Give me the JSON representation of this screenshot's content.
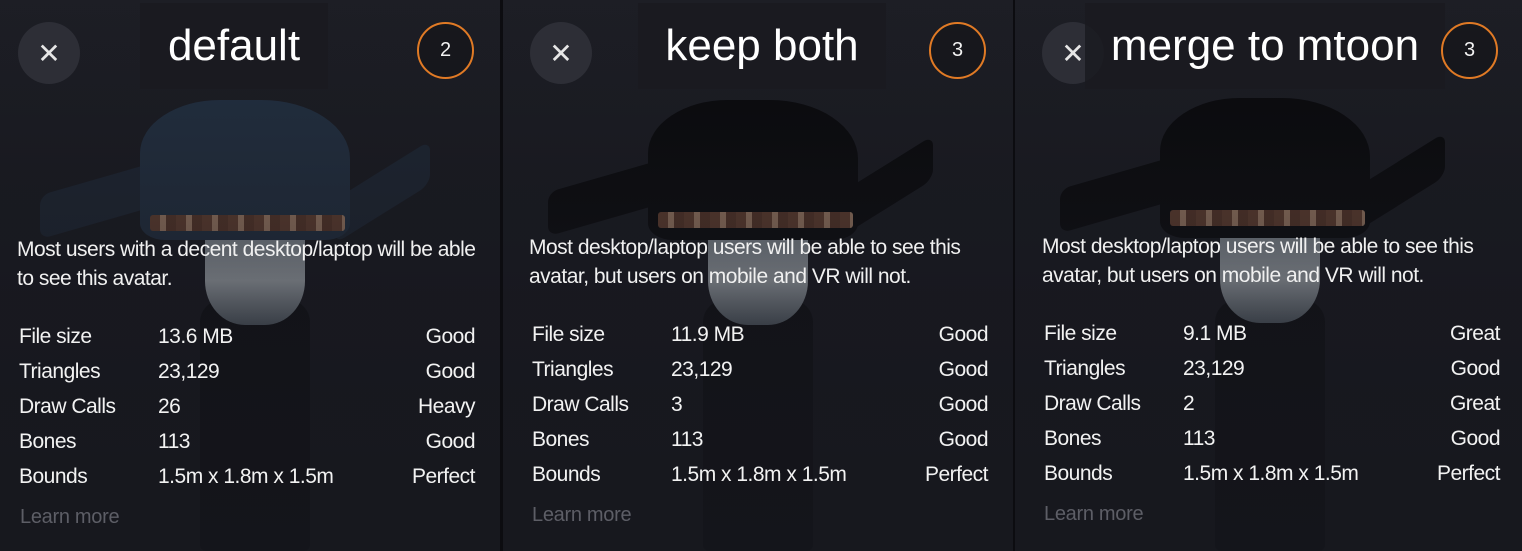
{
  "panels": [
    {
      "title": "default",
      "badge": "2",
      "description": "Most users with a decent desktop/laptop will be able to see this avatar.",
      "stats": [
        {
          "label": "File size",
          "value": "13.6 MB",
          "rating": "Good"
        },
        {
          "label": "Triangles",
          "value": "23,129",
          "rating": "Good"
        },
        {
          "label": "Draw Calls",
          "value": "26",
          "rating": "Heavy"
        },
        {
          "label": "Bones",
          "value": "113",
          "rating": "Good"
        },
        {
          "label": "Bounds",
          "value": "1.5m x 1.8m x 1.5m",
          "rating": "Perfect"
        }
      ],
      "learn_more": "Learn more"
    },
    {
      "title": "keep both",
      "badge": "3",
      "description": "Most desktop/laptop users will be able to see this avatar, but users on mobile and VR will not.",
      "stats": [
        {
          "label": "File size",
          "value": "11.9 MB",
          "rating": "Good"
        },
        {
          "label": "Triangles",
          "value": "23,129",
          "rating": "Good"
        },
        {
          "label": "Draw Calls",
          "value": "3",
          "rating": "Good"
        },
        {
          "label": "Bones",
          "value": "113",
          "rating": "Good"
        },
        {
          "label": "Bounds",
          "value": "1.5m x 1.8m x 1.5m",
          "rating": "Perfect"
        }
      ],
      "learn_more": "Learn more"
    },
    {
      "title": "merge to mtoon",
      "badge": "3",
      "description": "Most desktop/laptop users will be able to see this avatar, but users on mobile and VR will not.",
      "stats": [
        {
          "label": "File size",
          "value": "9.1 MB",
          "rating": "Great"
        },
        {
          "label": "Triangles",
          "value": "23,129",
          "rating": "Good"
        },
        {
          "label": "Draw Calls",
          "value": "2",
          "rating": "Great"
        },
        {
          "label": "Bones",
          "value": "113",
          "rating": "Good"
        },
        {
          "label": "Bounds",
          "value": "1.5m x 1.8m x 1.5m",
          "rating": "Perfect"
        }
      ],
      "learn_more": "Learn more"
    }
  ],
  "icons": {
    "close": "close-icon",
    "badge_ring_color": "#e07a25"
  }
}
